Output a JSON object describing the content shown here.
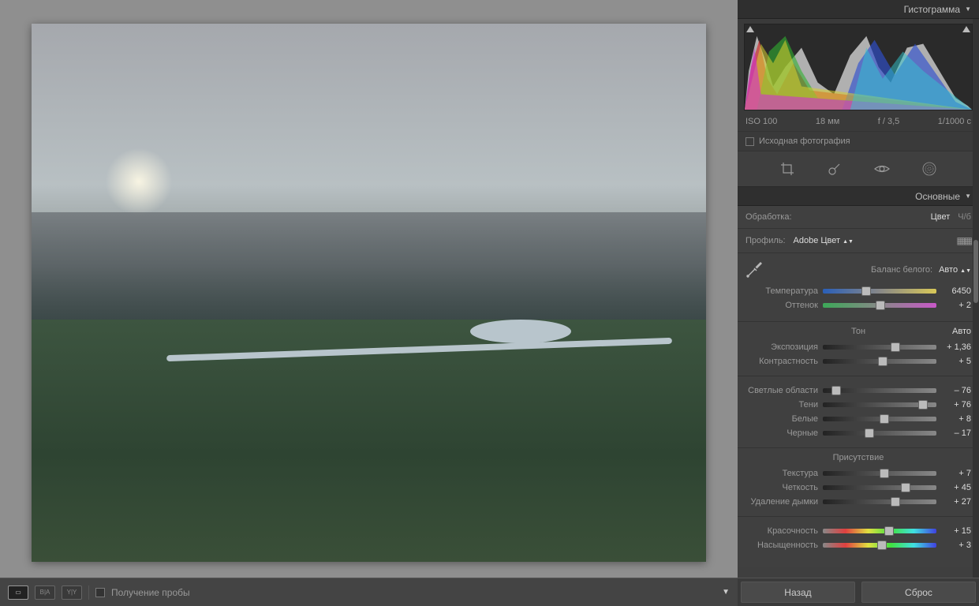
{
  "panels": {
    "histogram_title": "Гистограмма",
    "basic_title": "Основные"
  },
  "histogram": {
    "iso": "ISO 100",
    "focal": "18 мм",
    "aperture": "f / 3,5",
    "shutter": "1/1000 с",
    "original_label": "Исходная фотография"
  },
  "treatment": {
    "label": "Обработка:",
    "color": "Цвет",
    "bw": "Ч/б"
  },
  "profile": {
    "label": "Профиль:",
    "value": "Adobe Цвет"
  },
  "wb": {
    "label": "Баланс белого:",
    "preset": "Авто"
  },
  "sliders": {
    "temp_label": "Температура",
    "temp_value": "6450",
    "tint_label": "Оттенок",
    "tint_value": "+ 2",
    "tone_title": "Тон",
    "tone_auto": "Авто",
    "exposure_label": "Экспозиция",
    "exposure_value": "+ 1,36",
    "contrast_label": "Контрастность",
    "contrast_value": "+ 5",
    "highlights_label": "Светлые области",
    "highlights_value": "– 76",
    "shadows_label": "Тени",
    "shadows_value": "+ 76",
    "whites_label": "Белые",
    "whites_value": "+ 8",
    "blacks_label": "Черные",
    "blacks_value": "– 17",
    "presence_title": "Присутствие",
    "texture_label": "Текстура",
    "texture_value": "+ 7",
    "clarity_label": "Четкость",
    "clarity_value": "+ 45",
    "dehaze_label": "Удаление дымки",
    "dehaze_value": "+ 27",
    "vibrance_label": "Красочность",
    "vibrance_value": "+ 15",
    "saturation_label": "Насыщенность",
    "saturation_value": "+ 3"
  },
  "bottom": {
    "sample_label": "Получение пробы",
    "back": "Назад",
    "reset": "Сброс"
  }
}
